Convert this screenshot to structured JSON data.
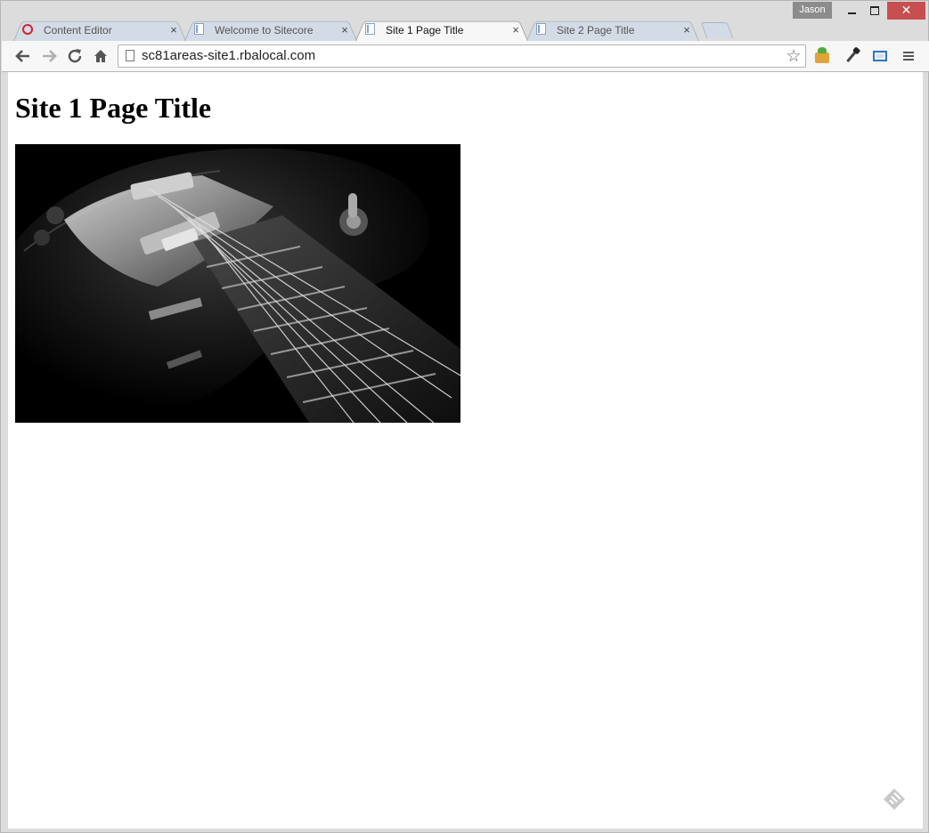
{
  "browser": {
    "user_name": "Jason",
    "tabs": [
      {
        "label": "Content Editor",
        "favicon": "sitecore-icon",
        "active": false
      },
      {
        "label": "Welcome to Sitecore",
        "favicon": "page-icon",
        "active": false
      },
      {
        "label": "Site 1 Page Title",
        "favicon": "page-icon",
        "active": true
      },
      {
        "label": "Site 2 Page Title",
        "favicon": "page-icon",
        "active": false
      }
    ],
    "tab_close_glyph": "×",
    "address_bar": {
      "url": "sc81areas-site1.rbalocal.com"
    },
    "toolbar_icons": [
      "back-arrow-icon",
      "forward-arrow-icon",
      "reload-icon",
      "home-icon",
      "star-icon",
      "extension-package-icon",
      "eyedropper-icon",
      "screen-capture-icon",
      "menu-icon"
    ]
  },
  "page": {
    "heading": "Site 1 Page Title",
    "image_subject": "guitar-photo"
  },
  "colors": {
    "window_close": "#c74f4f",
    "sitecore_red": "#d3222a"
  }
}
